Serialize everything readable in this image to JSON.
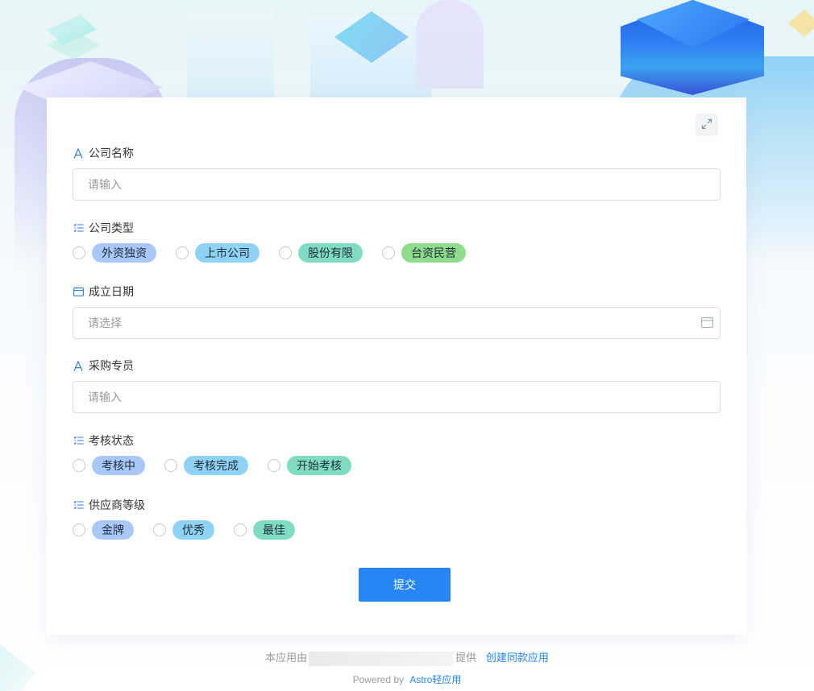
{
  "form": {
    "expand_icon": "expand-icon",
    "fields": {
      "company_name": {
        "label": "公司名称",
        "icon": "text-icon",
        "placeholder": "请输入"
      },
      "company_type": {
        "label": "公司类型",
        "icon": "list-icon",
        "options": [
          {
            "label": "外资独资",
            "color": "#a9c8f8"
          },
          {
            "label": "上市公司",
            "color": "#8ed3f3"
          },
          {
            "label": "股份有限",
            "color": "#7fdcc2"
          },
          {
            "label": "台资民营",
            "color": "#8fdd8c"
          }
        ]
      },
      "founded_date": {
        "label": "成立日期",
        "icon": "calendar-icon",
        "placeholder": "请选择"
      },
      "buyer": {
        "label": "采购专员",
        "icon": "text-icon",
        "placeholder": "请输入"
      },
      "review_status": {
        "label": "考核状态",
        "icon": "list-icon",
        "options": [
          {
            "label": "考核中",
            "color": "#a9c8f8"
          },
          {
            "label": "考核完成",
            "color": "#8ed3f3"
          },
          {
            "label": "开始考核",
            "color": "#7fdcc2"
          }
        ]
      },
      "supplier_level": {
        "label": "供应商等级",
        "icon": "list-icon",
        "options": [
          {
            "label": "金牌",
            "color": "#a9c8f8"
          },
          {
            "label": "优秀",
            "color": "#8ed3f3"
          },
          {
            "label": "最佳",
            "color": "#7fdcc2"
          }
        ]
      }
    },
    "submit_label": "提交"
  },
  "footer": {
    "provided_prefix": "本应用由",
    "provided_suffix": "提供",
    "create_link": "创建同款应用",
    "powered_by": "Powered by",
    "astro_link": "Astro轻应用"
  },
  "colors": {
    "accent": "#2686f7",
    "icon_blue": "#2e7fd6"
  }
}
